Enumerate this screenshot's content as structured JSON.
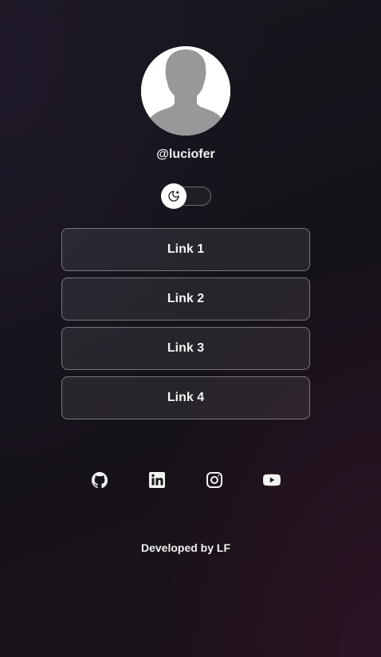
{
  "profile": {
    "username": "@luciofer",
    "avatar_icon": "default-user-silhouette-icon"
  },
  "theme_toggle": {
    "icon": "moon-icon",
    "state": "dark"
  },
  "links": [
    {
      "label": "Link 1"
    },
    {
      "label": "Link 2"
    },
    {
      "label": "Link 3"
    },
    {
      "label": "Link 4"
    }
  ],
  "socials": [
    {
      "name": "github",
      "icon": "github-icon"
    },
    {
      "name": "linkedin",
      "icon": "linkedin-icon"
    },
    {
      "name": "instagram",
      "icon": "instagram-icon"
    },
    {
      "name": "youtube",
      "icon": "youtube-icon"
    }
  ],
  "footer": {
    "text": "Developed by LF"
  },
  "colors": {
    "background": "#17131c",
    "text": "#f2f2f2",
    "button_bg": "#2a272e",
    "button_border": "#6f6c73"
  }
}
